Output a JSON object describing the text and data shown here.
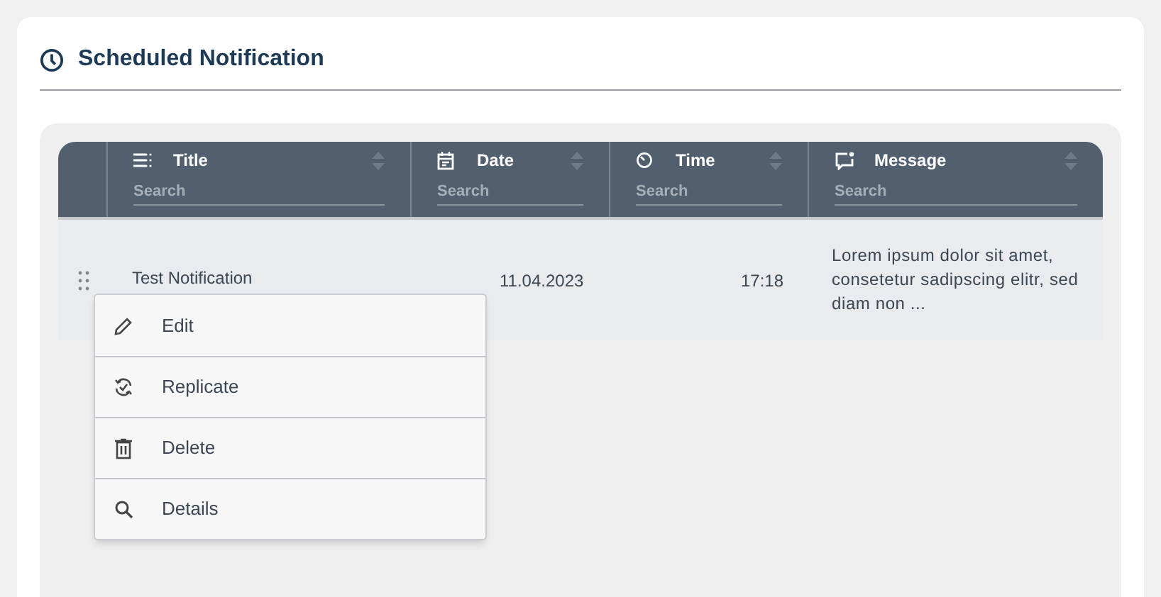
{
  "header": {
    "title": "Scheduled Notification"
  },
  "table": {
    "columns": [
      {
        "label": "Title",
        "placeholder": "Search"
      },
      {
        "label": "Date",
        "placeholder": "Search"
      },
      {
        "label": "Time",
        "placeholder": "Search"
      },
      {
        "label": "Message",
        "placeholder": "Search"
      }
    ],
    "rows": [
      {
        "title": "Test Notification",
        "date": "11.04.2023",
        "time": "17:18",
        "message": "Lorem ipsum dolor sit amet, consetetur sadipscing elitr, sed diam non ..."
      }
    ]
  },
  "context_menu": {
    "items": [
      {
        "label": "Edit"
      },
      {
        "label": "Replicate"
      },
      {
        "label": "Delete"
      },
      {
        "label": "Details"
      }
    ]
  }
}
